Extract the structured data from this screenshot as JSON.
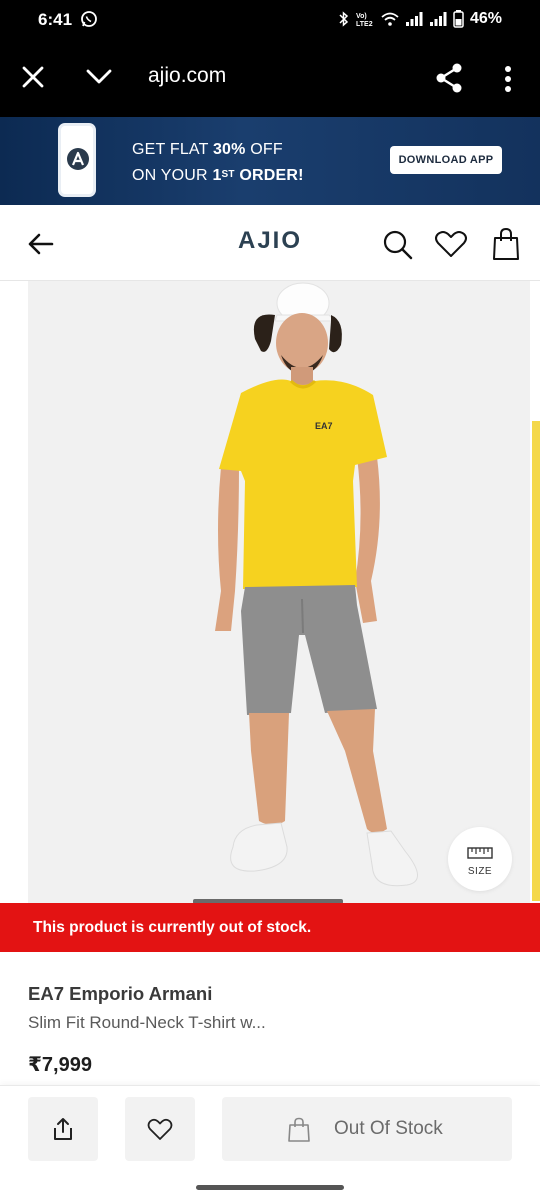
{
  "status_bar": {
    "time": "6:41",
    "battery": "46%",
    "icons": [
      "whatsapp-icon",
      "bluetooth-icon",
      "volte-icon",
      "wifi-icon",
      "signal-icon",
      "battery-icon"
    ]
  },
  "browser": {
    "url": "ajio.com",
    "icons": [
      "close-icon",
      "chevron-down-icon",
      "share-icon",
      "more-vert-icon"
    ]
  },
  "promo": {
    "line1_prefix": "GET FLAT ",
    "line1_bold": "30%",
    "line1_suffix": " OFF",
    "line2_prefix": "ON YOUR ",
    "line2_num": "1",
    "line2_sup": "ST",
    "line2_bold": " ORDER!",
    "download_label": "DOWNLOAD APP",
    "app_logo_letter": "A"
  },
  "header": {
    "logo": "AJIO",
    "icons": [
      "back-arrow-icon",
      "search-icon",
      "heart-icon",
      "bag-icon"
    ]
  },
  "product": {
    "size_label": "SIZE",
    "stock_message": "This product is currently out of stock.",
    "brand": "EA7 Emporio Armani",
    "name": "Slim Fit Round-Neck T-shirt w...",
    "price": "₹7,999",
    "tshirt_logo": "EA7"
  },
  "actions": {
    "out_of_stock_label": "Out Of Stock"
  },
  "colors": {
    "oos_red": "#e31313",
    "logo_navy": "#2c4152",
    "promo_navy": "#0c2a52",
    "tshirt_yellow": "#f6d21f",
    "shorts_grey": "#8e8e8e"
  }
}
